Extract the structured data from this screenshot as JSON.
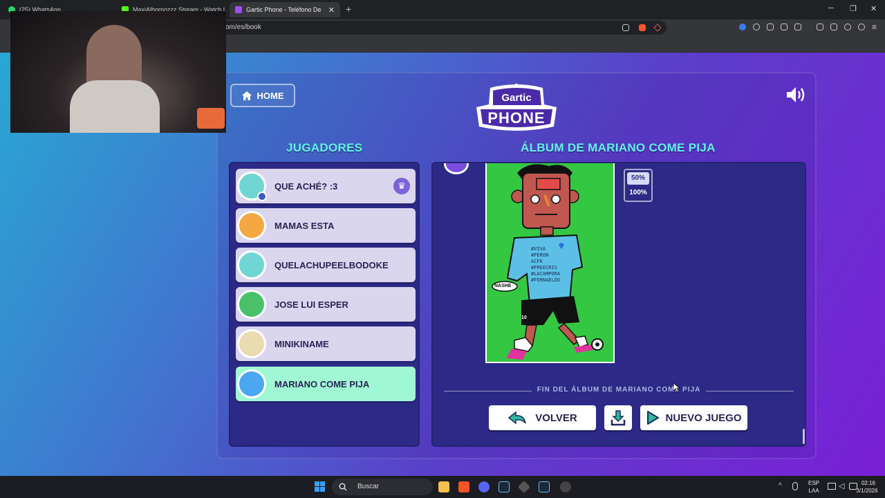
{
  "browser": {
    "tabs": [
      {
        "title": "(25) WhatsApp",
        "color": "#25d366"
      },
      {
        "title": "MaxiAlbornozzz Stream - Watch Live",
        "color": "#53fc18"
      },
      {
        "title": "Gartic Phone - Teléfono Descom",
        "color": "#9c4dff",
        "active": true
      }
    ],
    "new_tab": "+",
    "url": "om/es/book",
    "window_controls": {
      "minimize": "─",
      "maximize": "❐",
      "close": "✕"
    }
  },
  "app": {
    "home_label": "HOME",
    "logo_top": "Gartic",
    "logo_bottom": "PHONE",
    "players_title": "JUGADORES",
    "album_title": "ÁLBUM DE MARIANO COME PIJA",
    "players": [
      {
        "name": "QUE ACHÉ? :3",
        "color": "#6fd6d4",
        "host": true
      },
      {
        "name": "MAMAS ESTA",
        "color": "#f4a743"
      },
      {
        "name": "QUELACHUPEELBODOKE",
        "color": "#6fd6d4"
      },
      {
        "name": "JOSE LUI ESPER",
        "color": "#49c16b"
      },
      {
        "name": "MINIKINAME",
        "color": "#e8dcb0"
      },
      {
        "name": "MARIANO COME PIJA",
        "color": "#4aa7f0",
        "active": true
      }
    ],
    "crown_icon": "♛",
    "zoom_options": [
      "50%",
      "100%"
    ],
    "drawing_text": {
      "shirt_lines": [
        "#VIVA",
        "#PERON",
        "ACFK",
        "#FREECRIS",
        "#LACAMPORA",
        "#FERNAELDO"
      ],
      "sign": "NASHE",
      "number": "10"
    },
    "album_end": "FIN DEL ÁLBUM DE MARIANO COME PIJA",
    "buttons": {
      "volver": "VOLVER",
      "nuevo_juego": "NUEVO JUEGO"
    }
  },
  "taskbar": {
    "search_placeholder": "Buscar",
    "language": "ESP",
    "layout": "LAA",
    "time": "02:16",
    "date": "3/1/2026"
  },
  "colors": {
    "accent_title": "#5ff2e3",
    "panel": "#2c2a86",
    "active_player": "#9ff7d3"
  }
}
